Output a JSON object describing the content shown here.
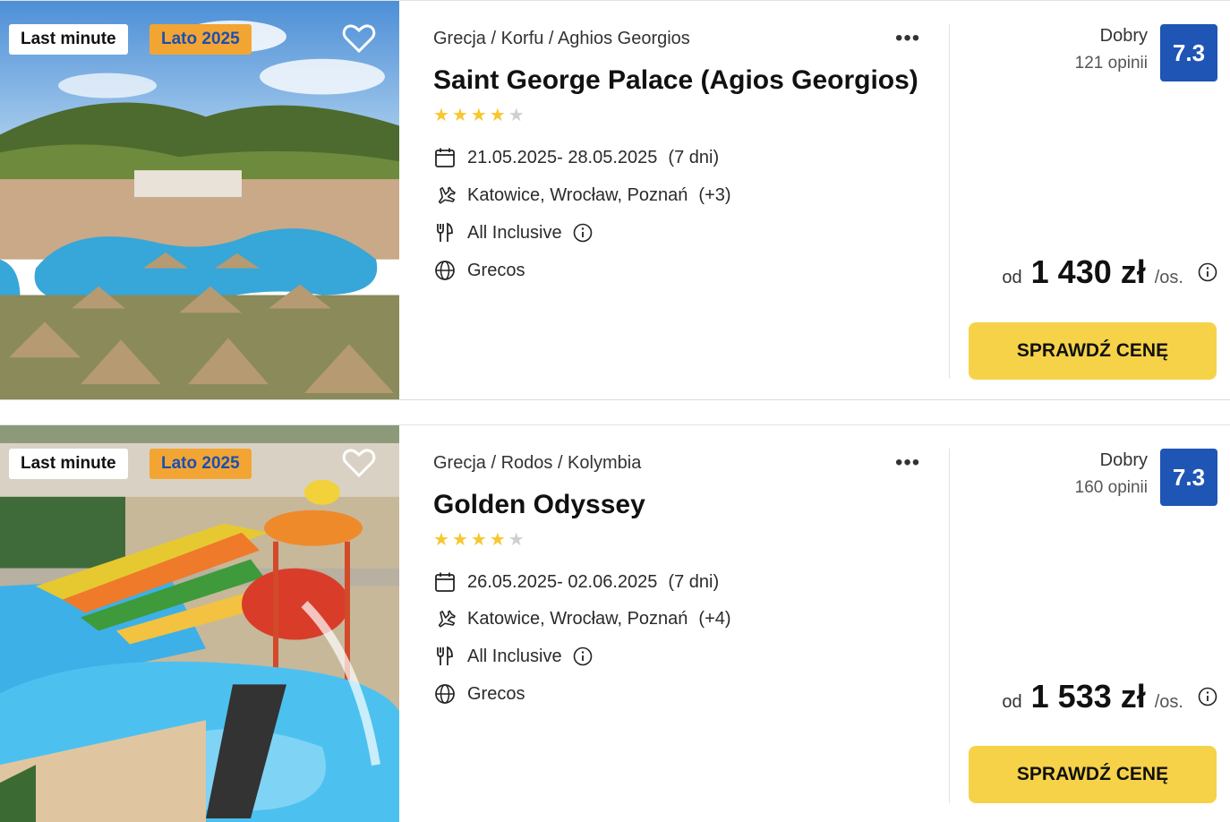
{
  "hotels": [
    {
      "badges": {
        "last_minute": "Last minute",
        "season": "Lato 2025"
      },
      "breadcrumb": "Grecja / Korfu / Aghios Georgios",
      "more": "•••",
      "name": "Saint George Palace (Agios Georgios)",
      "stars_filled": 4,
      "stars_total": 5,
      "dates": "21.05.2025- 28.05.2025",
      "duration": "(7 dni)",
      "departures": "Katowice, Wrocław, Poznań",
      "departures_extra": "(+3)",
      "board": "All Inclusive",
      "operator": "Grecos",
      "rating_label": "Dobry",
      "reviews": "121 opinii",
      "score": "7.3",
      "price_prefix": "od",
      "price": "1 430 zł",
      "price_suffix": "/os.",
      "cta": "SPRAWDŹ CENĘ"
    },
    {
      "badges": {
        "last_minute": "Last minute",
        "season": "Lato 2025"
      },
      "breadcrumb": "Grecja / Rodos / Kolymbia",
      "more": "•••",
      "name": "Golden Odyssey",
      "stars_filled": 4,
      "stars_total": 5,
      "dates": "26.05.2025- 02.06.2025",
      "duration": "(7 dni)",
      "departures": "Katowice, Wrocław, Poznań",
      "departures_extra": "(+4)",
      "board": "All Inclusive",
      "operator": "Grecos",
      "rating_label": "Dobry",
      "reviews": "160 opinii",
      "score": "7.3",
      "price_prefix": "od",
      "price": "1 533 zł",
      "price_suffix": "/os.",
      "cta": "SPRAWDŹ CENĘ"
    }
  ],
  "colors": {
    "accent_cta": "#f6d248",
    "score_bg": "#1f55b4",
    "season_badge": "#f3a533",
    "star": "#f7c730"
  },
  "icons": [
    "heart-icon",
    "calendar-icon",
    "plane-icon",
    "cutlery-icon",
    "info-icon",
    "globe-icon",
    "more-icon"
  ]
}
